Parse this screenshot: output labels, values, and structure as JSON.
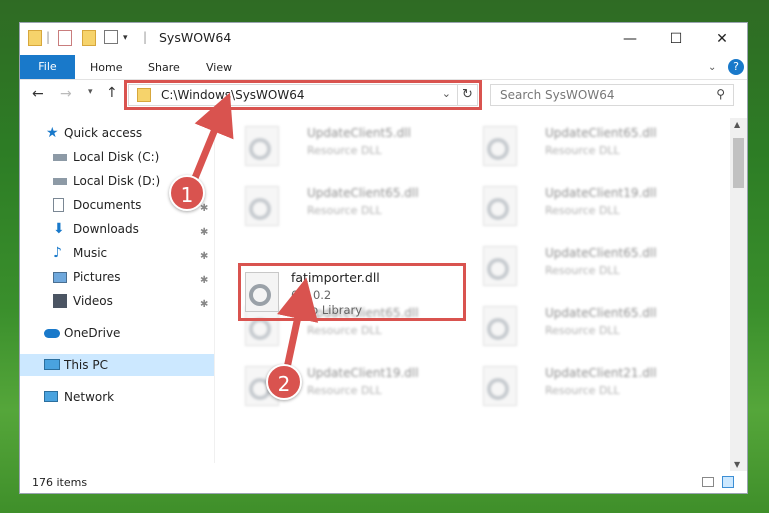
{
  "window": {
    "title": "SysWOW64",
    "controls": {
      "minimize": "—",
      "maximize": "☐",
      "close": "✕"
    }
  },
  "ribbon": {
    "tabs": [
      "File",
      "Home",
      "Share",
      "View"
    ],
    "help_icon": "?"
  },
  "navigation": {
    "address": "C:\\Windows\\SysWOW64",
    "search_placeholder": "Search SysWOW64"
  },
  "sidebar": {
    "items": [
      {
        "label": "Quick access",
        "icon": "star-icon"
      },
      {
        "label": "Local Disk (C:)",
        "icon": "drive-icon"
      },
      {
        "label": "Local Disk (D:)",
        "icon": "drive-icon"
      },
      {
        "label": "Documents",
        "icon": "documents-icon"
      },
      {
        "label": "Downloads",
        "icon": "downloads-icon"
      },
      {
        "label": "Music",
        "icon": "music-icon"
      },
      {
        "label": "Pictures",
        "icon": "pictures-icon"
      },
      {
        "label": "Videos",
        "icon": "videos-icon"
      },
      {
        "label": "OneDrive",
        "icon": "cloud-icon"
      },
      {
        "label": "This PC",
        "icon": "computer-icon",
        "selected": true
      },
      {
        "label": "Network",
        "icon": "network-icon"
      }
    ]
  },
  "files": {
    "background": [
      {
        "name": "UpdateClient5.dll",
        "type": "Resource DLL"
      },
      {
        "name": "UpdateClient65.dll",
        "type": "Resource DLL"
      },
      {
        "name": "UpdateClient65.dll",
        "type": "Resource DLL"
      },
      {
        "name": "UpdateClient19.dll",
        "type": "Resource DLL"
      },
      {
        "name": "UpdateClient65.dll",
        "type": "Resource DLL"
      },
      {
        "name": "UpdateClient65.dll",
        "type": "Resource DLL"
      },
      {
        "name": "UpdateClient65.dll",
        "type": "Resource DLL"
      },
      {
        "name": "UpdateClient19.dll",
        "type": "Resource DLL"
      },
      {
        "name": "UpdateClient21.dll",
        "type": "Resource DLL"
      }
    ],
    "featured": {
      "name": "fatimporter.dll",
      "version": "6.3.0.2",
      "type": "Nero Library"
    }
  },
  "status": {
    "item_count": "176 items"
  },
  "callouts": [
    "1",
    "2"
  ],
  "colors": {
    "accent": "#1979ca",
    "highlight": "#d9534f",
    "selected": "#cce8ff"
  }
}
